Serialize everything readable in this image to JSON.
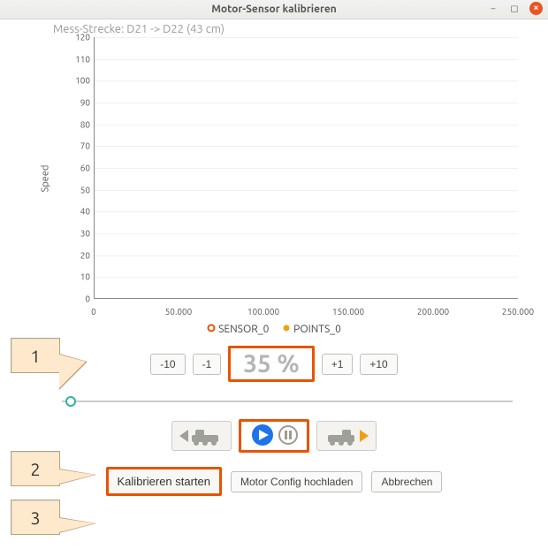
{
  "window": {
    "title": "Motor-Sensor kalibrieren",
    "subtitle": "Mess-Strecke: D21 -> D22 (43 cm)"
  },
  "chart_data": {
    "type": "scatter",
    "title": "",
    "xlabel": "",
    "ylabel": "Speed",
    "xlim": [
      0,
      250000
    ],
    "ylim": [
      0,
      120
    ],
    "xticks": [
      "0",
      "50.000",
      "100.000",
      "150.000",
      "200.000",
      "250.000"
    ],
    "yticks": [
      0,
      10,
      20,
      30,
      40,
      50,
      60,
      70,
      80,
      90,
      100,
      110,
      120
    ],
    "series": [
      {
        "name": "SENSOR_0",
        "color": "#e95302",
        "marker": "circle-open",
        "x": [],
        "y": []
      },
      {
        "name": "POINTS_0",
        "color": "#f0a010",
        "marker": "circle",
        "x": [],
        "y": []
      }
    ]
  },
  "speed": {
    "minus10": "-10",
    "minus1": "-1",
    "value": "35",
    "unit": "%",
    "plus1": "+1",
    "plus10": "+10",
    "slider_percent": 2
  },
  "actions": {
    "calibrate": "Kalibrieren starten",
    "upload": "Motor Config hochladen",
    "cancel": "Abbrechen"
  },
  "callouts": {
    "c1": "1",
    "c2": "2",
    "c3": "3"
  }
}
